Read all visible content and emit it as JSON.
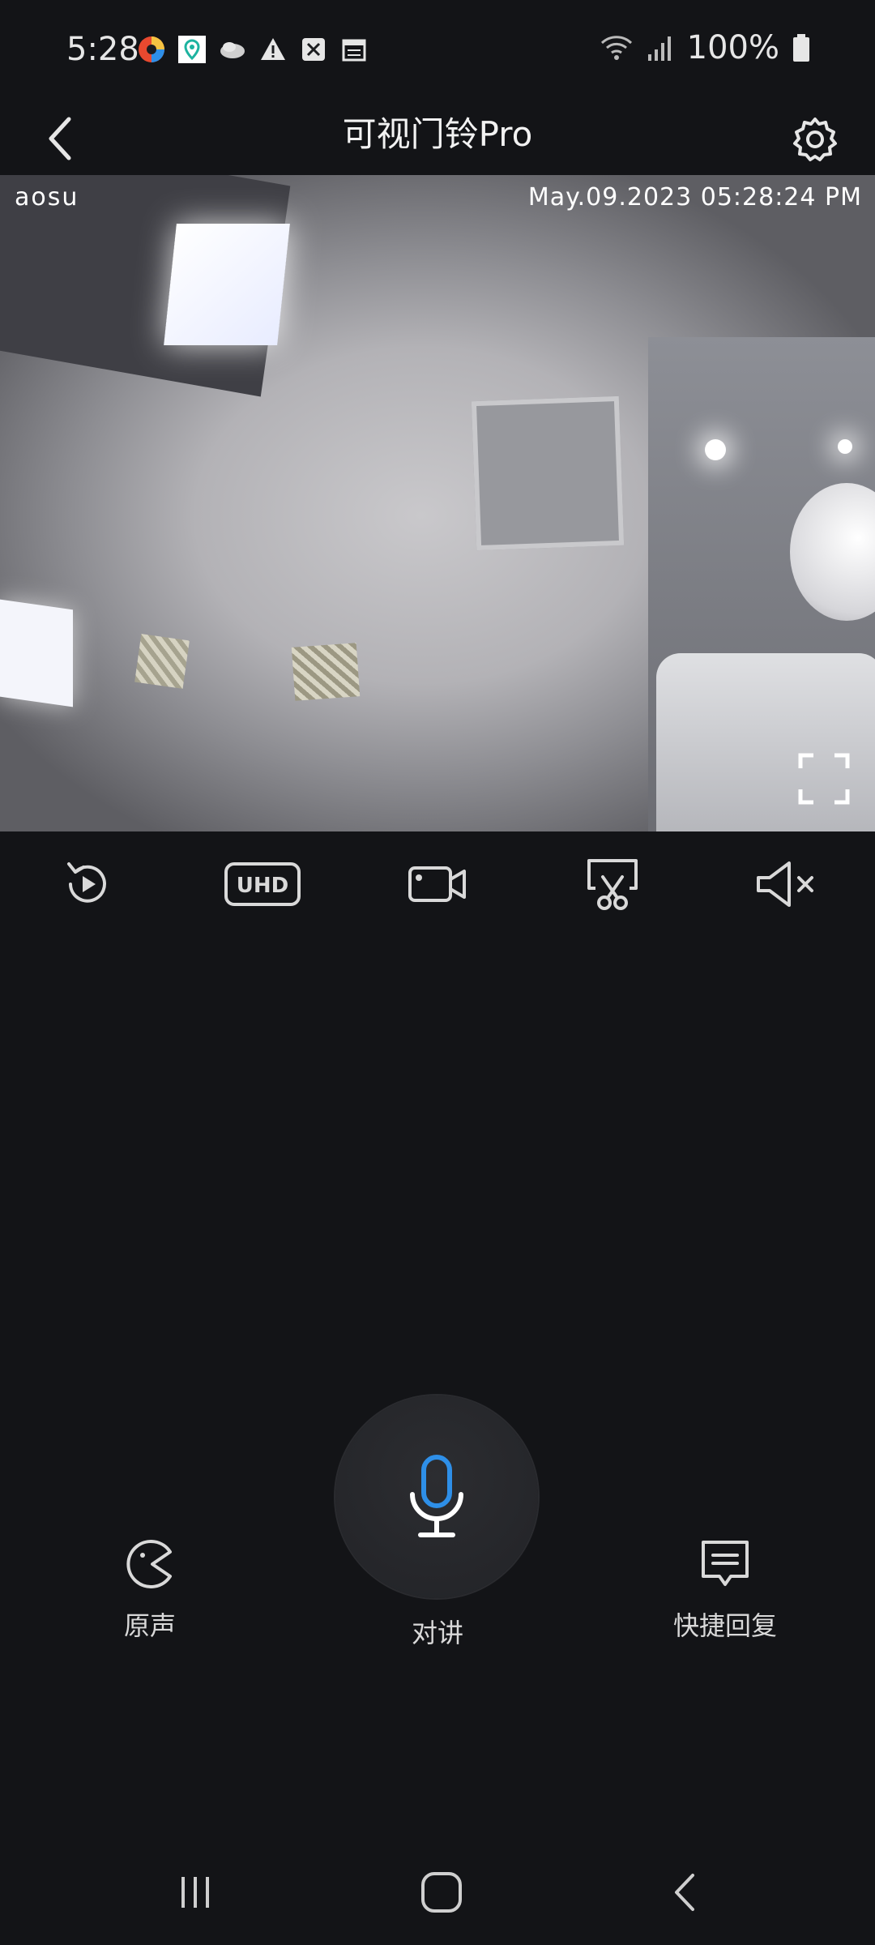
{
  "status_bar": {
    "time": "5:28",
    "battery": "100%"
  },
  "header": {
    "title": "可视门铃Pro"
  },
  "video": {
    "brand": "aosu",
    "timestamp": "May.09.2023 05:28:24 PM"
  },
  "toolbar": {
    "quality_label": "UHD"
  },
  "controls": {
    "original_sound_label": "原声",
    "talk_label": "对讲",
    "quick_reply_label": "快捷回复"
  },
  "colors": {
    "background": "#131417",
    "accent_mic": "#2e8fe8"
  }
}
